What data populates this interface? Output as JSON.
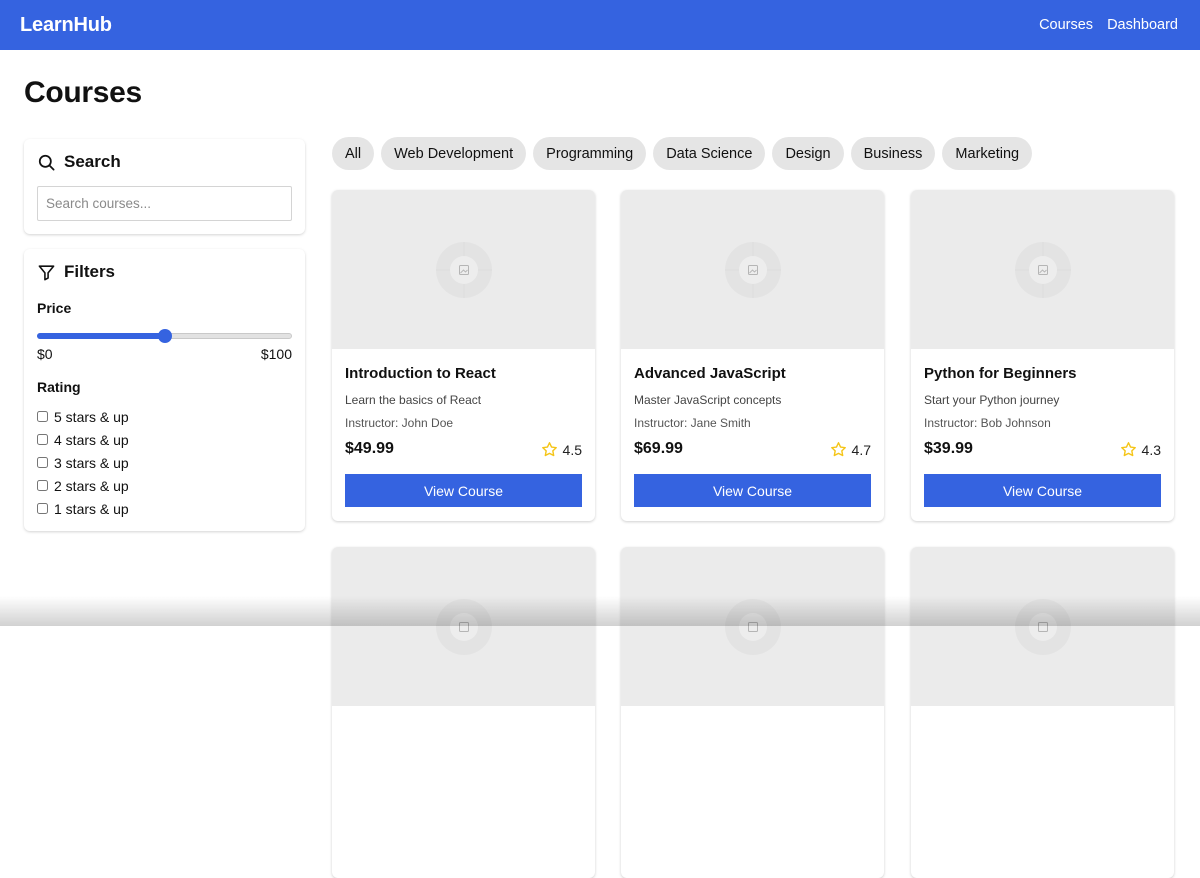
{
  "header": {
    "brand": "LearnHub",
    "nav": [
      "Courses",
      "Dashboard"
    ]
  },
  "page": {
    "title": "Courses"
  },
  "search": {
    "heading": "Search",
    "placeholder": "Search courses..."
  },
  "filters": {
    "heading": "Filters",
    "price_label": "Price",
    "price_min": "$0",
    "price_max": "$100",
    "price_slider_fraction": 0.5,
    "rating_label": "Rating",
    "rating_options": [
      "5 stars & up",
      "4 stars & up",
      "3 stars & up",
      "2 stars & up",
      "1 stars & up"
    ]
  },
  "categories": [
    "All",
    "Web Development",
    "Programming",
    "Data Science",
    "Design",
    "Business",
    "Marketing"
  ],
  "courses": [
    {
      "title": "Introduction to React",
      "description": "Learn the basics of React",
      "instructor": "Instructor: John Doe",
      "price": "$49.99",
      "rating": "4.5",
      "button": "View Course"
    },
    {
      "title": "Advanced JavaScript",
      "description": "Master JavaScript concepts",
      "instructor": "Instructor: Jane Smith",
      "price": "$69.99",
      "rating": "4.7",
      "button": "View Course"
    },
    {
      "title": "Python for Beginners",
      "description": "Start your Python journey",
      "instructor": "Instructor: Bob Johnson",
      "price": "$39.99",
      "rating": "4.3",
      "button": "View Course"
    }
  ],
  "colors": {
    "primary": "#3563e0",
    "chip_bg": "#e5e5e5",
    "thumb_bg": "#ebebeb",
    "star": "#f5c518"
  },
  "icons": {
    "search": "search-icon",
    "filter": "filter-icon",
    "star": "star-icon",
    "image_placeholder": "image-placeholder-icon"
  }
}
